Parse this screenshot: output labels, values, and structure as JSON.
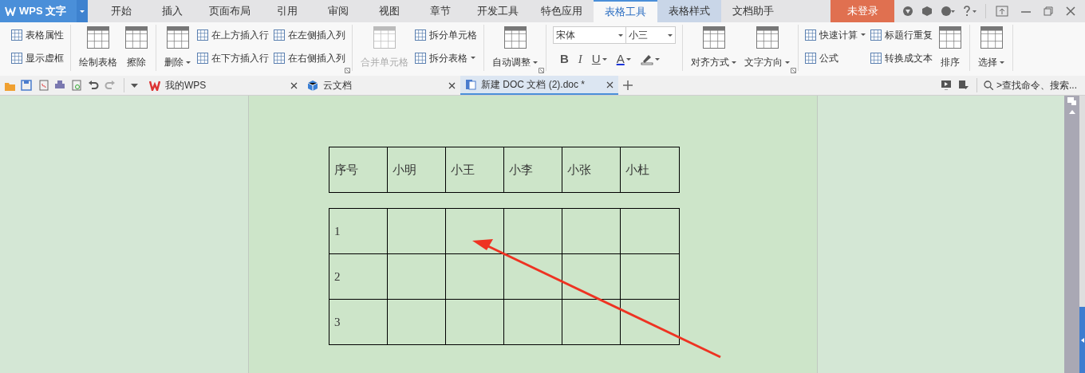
{
  "title_bar": {
    "logo": "WPS 文字",
    "menu_tabs": [
      {
        "label": "开始",
        "selected": false
      },
      {
        "label": "插入",
        "selected": false
      },
      {
        "label": "页面布局",
        "selected": false
      },
      {
        "label": "引用",
        "selected": false
      },
      {
        "label": "审阅",
        "selected": false
      },
      {
        "label": "视图",
        "selected": false
      },
      {
        "label": "章节",
        "selected": false
      },
      {
        "label": "开发工具",
        "selected": false
      },
      {
        "label": "特色应用",
        "selected": false
      },
      {
        "label": "表格工具",
        "selected": true
      },
      {
        "label": "表格样式",
        "selected": false
      },
      {
        "label": "文档助手",
        "selected": false
      }
    ],
    "login": "未登录"
  },
  "ribbon": {
    "groups": [
      {
        "kind": "buttons",
        "launcher": false,
        "items": [
          {
            "label": "表格属性",
            "kind": "small",
            "dropdown": false,
            "disabled": false
          },
          {
            "label": "显示虚框",
            "kind": "small",
            "dropdown": false,
            "disabled": false
          }
        ]
      },
      {
        "kind": "buttons",
        "launcher": false,
        "items": [
          {
            "label": "绘制表格",
            "kind": "large",
            "dropdown": false,
            "disabled": false
          },
          {
            "label": "擦除",
            "kind": "large",
            "dropdown": false,
            "disabled": false
          }
        ]
      },
      {
        "kind": "buttons",
        "launcher": true,
        "items": [
          {
            "label": "删除",
            "kind": "large",
            "dropdown": true,
            "disabled": false
          },
          {
            "label": "在上方插入行",
            "kind": "small",
            "dropdown": false,
            "disabled": false
          },
          {
            "label": "在下方插入行",
            "kind": "small",
            "dropdown": false,
            "disabled": false
          },
          {
            "label": "在左侧插入列",
            "kind": "small",
            "dropdown": false,
            "disabled": false
          },
          {
            "label": "在右侧插入列",
            "kind": "small",
            "dropdown": false,
            "disabled": false
          }
        ]
      },
      {
        "kind": "buttons",
        "launcher": false,
        "items": [
          {
            "label": "合并单元格",
            "kind": "large",
            "dropdown": false,
            "disabled": true
          },
          {
            "label": "拆分单元格",
            "kind": "small",
            "dropdown": false,
            "disabled": false
          },
          {
            "label": "拆分表格",
            "kind": "small",
            "dropdown": true,
            "disabled": false
          }
        ]
      },
      {
        "kind": "buttons",
        "launcher": true,
        "items": [
          {
            "label": "自动调整",
            "kind": "large",
            "dropdown": true,
            "disabled": false
          }
        ]
      },
      {
        "kind": "font",
        "launcher": false,
        "font": "宋体",
        "size": "小三",
        "format_buttons": [
          {
            "label": "B",
            "dropdown": false
          },
          {
            "label": "I",
            "dropdown": false
          },
          {
            "label": "U",
            "dropdown": true
          },
          {
            "label": "A",
            "dropdown": true
          }
        ]
      },
      {
        "kind": "buttons",
        "launcher": true,
        "items": [
          {
            "label": "对齐方式",
            "kind": "large",
            "dropdown": true,
            "disabled": false
          },
          {
            "label": "文字方向",
            "kind": "large",
            "dropdown": true,
            "disabled": false
          }
        ]
      },
      {
        "kind": "buttons",
        "launcher": false,
        "items": [
          {
            "label": "快速计算",
            "kind": "small",
            "dropdown": true,
            "disabled": false
          },
          {
            "label": "公式",
            "kind": "small",
            "dropdown": false,
            "disabled": false
          },
          {
            "label": "标题行重复",
            "kind": "small",
            "dropdown": false,
            "disabled": false
          },
          {
            "label": "转换成文本",
            "kind": "small",
            "dropdown": false,
            "disabled": false
          },
          {
            "label": "排序",
            "kind": "large",
            "dropdown": false,
            "disabled": false
          }
        ]
      },
      {
        "kind": "buttons",
        "launcher": false,
        "items": [
          {
            "label": "选择",
            "kind": "large",
            "dropdown": true,
            "disabled": false
          }
        ]
      }
    ]
  },
  "doc_tabs": [
    {
      "label": "我的WPS",
      "selected": false
    },
    {
      "label": "云文档",
      "selected": false
    },
    {
      "label": "新建 DOC 文档 (2).doc *",
      "selected": true
    }
  ],
  "search": {
    "placeholder": ">查找命令、搜索..."
  },
  "document": {
    "header_table": {
      "rows": [
        [
          "序号",
          "小明",
          "小王",
          "小李",
          "小张",
          "小杜"
        ]
      ]
    },
    "data_table": {
      "rows": [
        [
          "1",
          "",
          "",
          "",
          "",
          ""
        ],
        [
          "2",
          "",
          "",
          "",
          "",
          ""
        ],
        [
          "3",
          "",
          "",
          "",
          "",
          ""
        ]
      ]
    }
  }
}
